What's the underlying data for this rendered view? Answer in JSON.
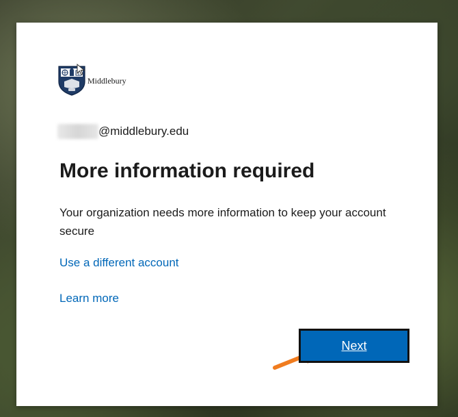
{
  "branding": {
    "name": "Middlebury",
    "logo_icon": "middlebury-crest",
    "accent_color": "#0067b8"
  },
  "account": {
    "email_domain": "@middlebury.edu"
  },
  "main": {
    "title": "More information required",
    "description": "Your organization needs more information to keep your account secure",
    "links": [
      {
        "label": "Use a different account"
      },
      {
        "label": "Learn more"
      }
    ],
    "next_label": "Next"
  },
  "annotations": {
    "arrow_color": "#f07c1f"
  }
}
